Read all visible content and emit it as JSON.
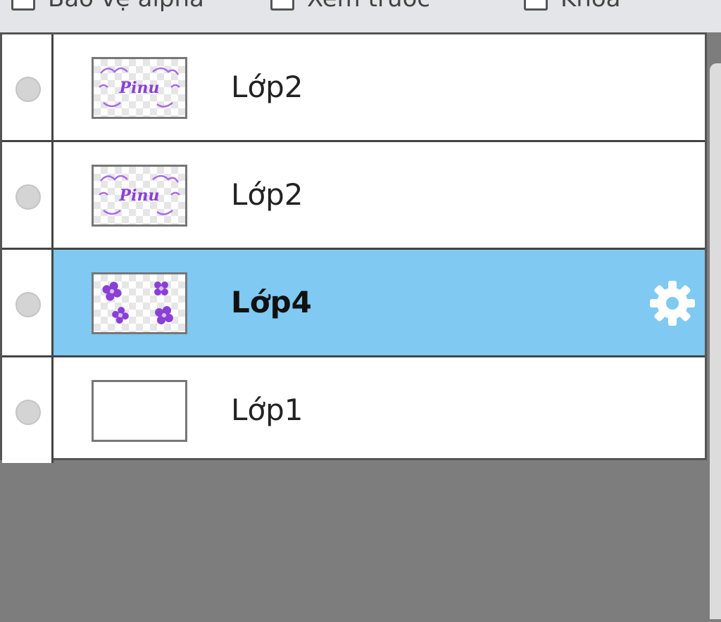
{
  "options": {
    "alpha_protect": "Bảo vệ alpha",
    "preview": "Xem trước",
    "lock": "Khóa"
  },
  "layers": [
    {
      "name": "Lớp2",
      "selected": false,
      "thumb": "text-purple"
    },
    {
      "name": "Lớp2",
      "selected": false,
      "thumb": "text-purple"
    },
    {
      "name": "Lớp4",
      "selected": true,
      "thumb": "flowers-purple"
    },
    {
      "name": "Lớp1",
      "selected": false,
      "thumb": "blank"
    }
  ],
  "colors": {
    "selected_row": "#7fc9f2",
    "panel_background": "#7d7d7d",
    "thumb_art": "#8a3fd6"
  },
  "icons": {
    "visibility": "visibility-dot-icon",
    "settings": "gear-icon"
  }
}
